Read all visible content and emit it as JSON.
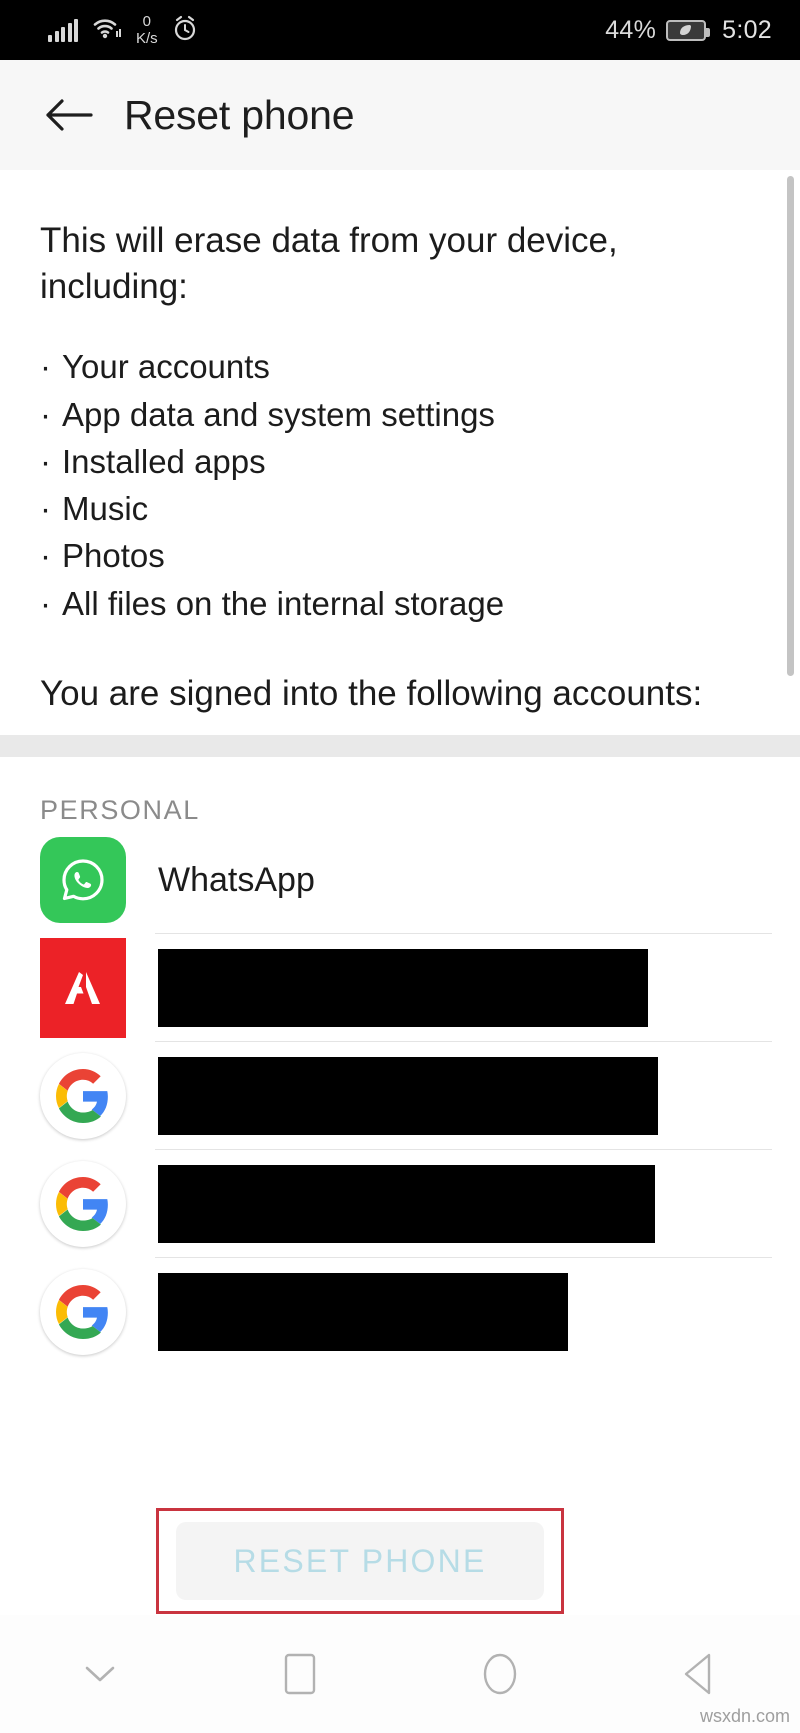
{
  "status_bar": {
    "network_speed_value": "0",
    "network_speed_unit": "K/s",
    "battery_percent": "44%",
    "time": "5:02",
    "icons": [
      "signal-bars-icon",
      "wifi-hotspot-icon",
      "alarm-clock-icon",
      "battery-saver-icon"
    ]
  },
  "app_bar": {
    "back_label": "back-arrow-icon",
    "title": "Reset phone"
  },
  "body": {
    "erase_heading": "This will erase data from your device, including:",
    "bullet_marker": "·",
    "bullets": [
      "Your accounts",
      "App data and system settings",
      "Installed apps",
      "Music",
      "Photos",
      "All files on the internal storage"
    ],
    "signed_in_heading": "You are signed into the following accounts:"
  },
  "accounts_section": {
    "label": "PERSONAL",
    "rows": [
      {
        "icon": "whatsapp-icon",
        "name": "WhatsApp",
        "redacted": false,
        "redaction_width": 0
      },
      {
        "icon": "adobe-icon",
        "name": "",
        "redacted": true,
        "redaction_width": 490
      },
      {
        "icon": "google-icon",
        "name": "",
        "redacted": true,
        "redaction_width": 500
      },
      {
        "icon": "google-icon",
        "name": "",
        "redacted": true,
        "redaction_width": 497
      },
      {
        "icon": "google-icon",
        "name": "",
        "redacted": true,
        "redaction_width": 410
      }
    ]
  },
  "reset_button": {
    "label": "RESET PHONE",
    "state": "disabled",
    "text_color": "#b6dce6",
    "highlight_color": "#c9343f"
  },
  "nav_bar": {
    "buttons": [
      {
        "name": "hide-keyboard-icon"
      },
      {
        "name": "recents-square-icon"
      },
      {
        "name": "home-circle-icon"
      },
      {
        "name": "back-triangle-icon"
      }
    ]
  },
  "watermark": {
    "text": "wsxdn.com"
  }
}
